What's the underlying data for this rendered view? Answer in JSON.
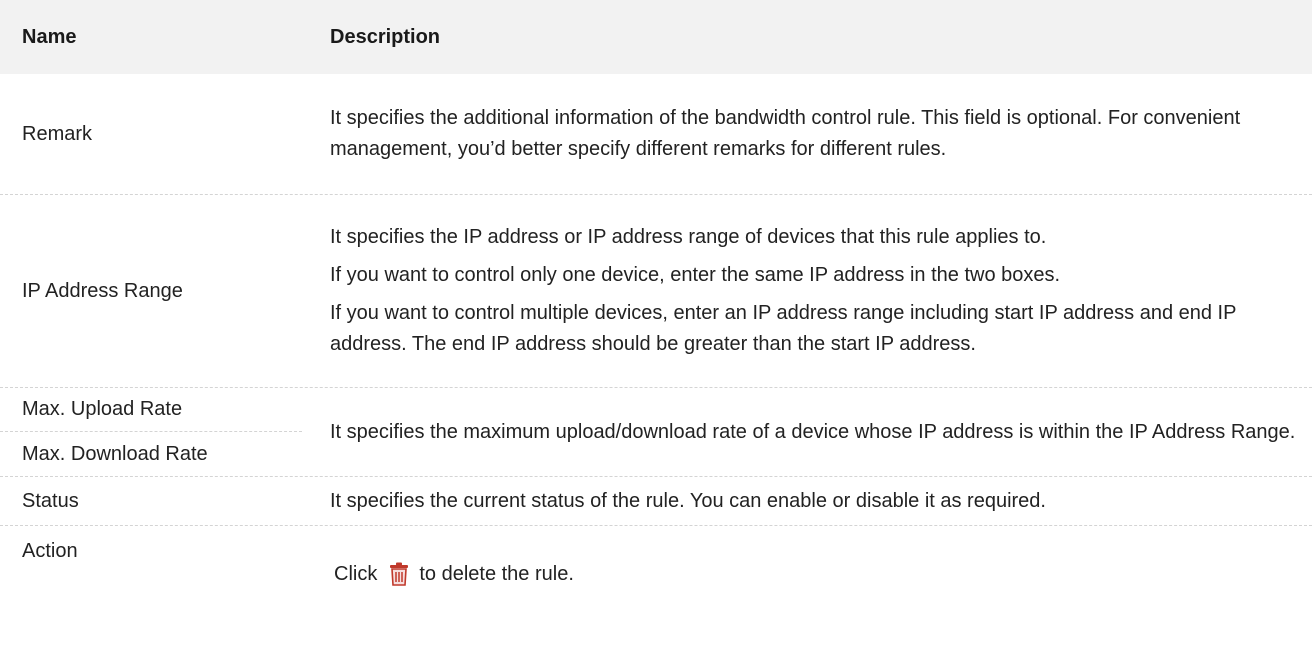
{
  "header": {
    "name_col": "Name",
    "desc_col": "Description"
  },
  "rows": [
    {
      "name": "Remark",
      "description": [
        "It specifies the additional information of the bandwidth control rule. This field is optional. For convenient management, you’d better specify different remarks for different rules."
      ]
    },
    {
      "name": "IP Address Range",
      "description": [
        "It specifies the IP address or IP address range of devices that this rule applies to.",
        "If you want to control only one device, enter the same IP address in the two boxes.",
        "If you want to control multiple devices, enter an IP address range including start IP address and end IP address. The end IP address should be greater than the start IP address."
      ]
    },
    {
      "name_upload": "Max. Upload Rate",
      "name_download": "Max. Download Rate",
      "description": [
        "It specifies the maximum upload/download rate of a device whose IP address is within the IP Address Range."
      ]
    },
    {
      "name": "Status",
      "description": [
        "It specifies the current status of the rule. You can enable or disable it as required."
      ]
    },
    {
      "name": "Action",
      "description_before": "Click",
      "description_after": "to delete the rule.",
      "icon": "trash-icon"
    }
  ],
  "colors": {
    "header_bg": "#f2f2f2",
    "icon_color": "#c0392b"
  }
}
